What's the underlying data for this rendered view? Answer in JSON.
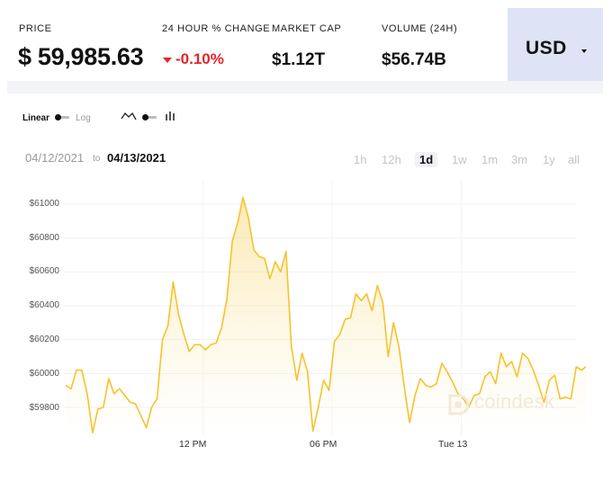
{
  "header": {
    "price_label": "PRICE",
    "price_value": "$ 59,985.63",
    "change_label": "24 HOUR % CHANGE",
    "change_value": "-0.10%",
    "market_cap_label": "MARKET CAP",
    "market_cap_value": "$1.12T",
    "volume_label": "VOLUME (24H)",
    "volume_value": "$56.74B",
    "currency": "USD"
  },
  "controls": {
    "scale_linear": "Linear",
    "scale_log": "Log",
    "date_from": "04/12/2021",
    "date_to_word": "to",
    "date_to": "04/13/2021",
    "ranges": [
      "1h",
      "12h",
      "1d",
      "1w",
      "1m",
      "3m",
      "1y",
      "all"
    ],
    "active_range": "1d"
  },
  "watermark": "coindesk",
  "colors": {
    "line": "#f5c32c",
    "negative": "#e5252a",
    "currency_bg": "#dfe3f6"
  },
  "chart_data": {
    "type": "area",
    "y_tick_labels": [
      "$61000",
      "$60800",
      "$60600",
      "$60400",
      "$60200",
      "$60000",
      "$59800"
    ],
    "y_ticks": [
      61000,
      60800,
      60600,
      60400,
      60200,
      60000,
      59800
    ],
    "ylim": [
      59650,
      61100
    ],
    "x_tick_labels": [
      "12 PM",
      "06 PM",
      "Tue 13"
    ],
    "x_tick_positions": [
      30,
      36,
      42
    ],
    "xlim": [
      23.6,
      47.8
    ],
    "x_unit": "hours since 04/12/2021 00:00",
    "grid": true,
    "series": [
      {
        "x": [
          23.6,
          23.85,
          24.1,
          24.35,
          24.6,
          24.85,
          25.1,
          25.35,
          25.6,
          25.85,
          26.1,
          26.35,
          26.6,
          26.85,
          27.1,
          27.35,
          27.6,
          27.85,
          28.1,
          28.35,
          28.6,
          28.85,
          29.1,
          29.35,
          29.6,
          29.85,
          30.1,
          30.35,
          30.6,
          30.85,
          31.1,
          31.35,
          31.6,
          31.85,
          32.1,
          32.35,
          32.6,
          32.85,
          33.1,
          33.35,
          33.6,
          33.85,
          34.1,
          34.35,
          34.6,
          34.85,
          35.1,
          35.35,
          35.6,
          35.85,
          36.1,
          36.35,
          36.6,
          36.85,
          37.1,
          37.35,
          37.6,
          37.85,
          38.1,
          38.35,
          38.6,
          38.85,
          39.1,
          39.35,
          39.6,
          39.85,
          40.1,
          40.35,
          40.6,
          40.85,
          41.1,
          41.35,
          41.6,
          41.85,
          42.1,
          42.35,
          42.6,
          42.85,
          43.1,
          43.35,
          43.6,
          43.85,
          44.1,
          44.35,
          44.6,
          44.85,
          45.1,
          45.35,
          45.6,
          45.85,
          46.1,
          46.35,
          46.6,
          46.85,
          47.1,
          47.35,
          47.6,
          47.8
        ],
        "values": [
          59930,
          59910,
          60020,
          60020,
          59880,
          59650,
          59790,
          59800,
          59970,
          59880,
          59910,
          59870,
          59830,
          59820,
          59750,
          59680,
          59800,
          59850,
          60200,
          60280,
          60540,
          60350,
          60230,
          60130,
          60170,
          60170,
          60140,
          60170,
          60180,
          60270,
          60440,
          60780,
          60890,
          61040,
          60920,
          60730,
          60690,
          60680,
          60560,
          60660,
          60600,
          60720,
          60160,
          59960,
          60120,
          60010,
          59660,
          59800,
          59960,
          59900,
          60190,
          60230,
          60320,
          60330,
          60470,
          60430,
          60470,
          60370,
          60520,
          60420,
          60100,
          60300,
          60160,
          59920,
          59710,
          59870,
          59970,
          59930,
          59920,
          59940,
          60060,
          60010,
          59950,
          59880,
          59850,
          59800,
          59870,
          59880,
          59980,
          60010,
          59940,
          60120,
          60040,
          60070,
          59980,
          60120,
          60090,
          60020,
          59930,
          59830,
          59960,
          59990,
          59850,
          59860,
          59850,
          60040,
          60020,
          60040
        ]
      }
    ]
  }
}
